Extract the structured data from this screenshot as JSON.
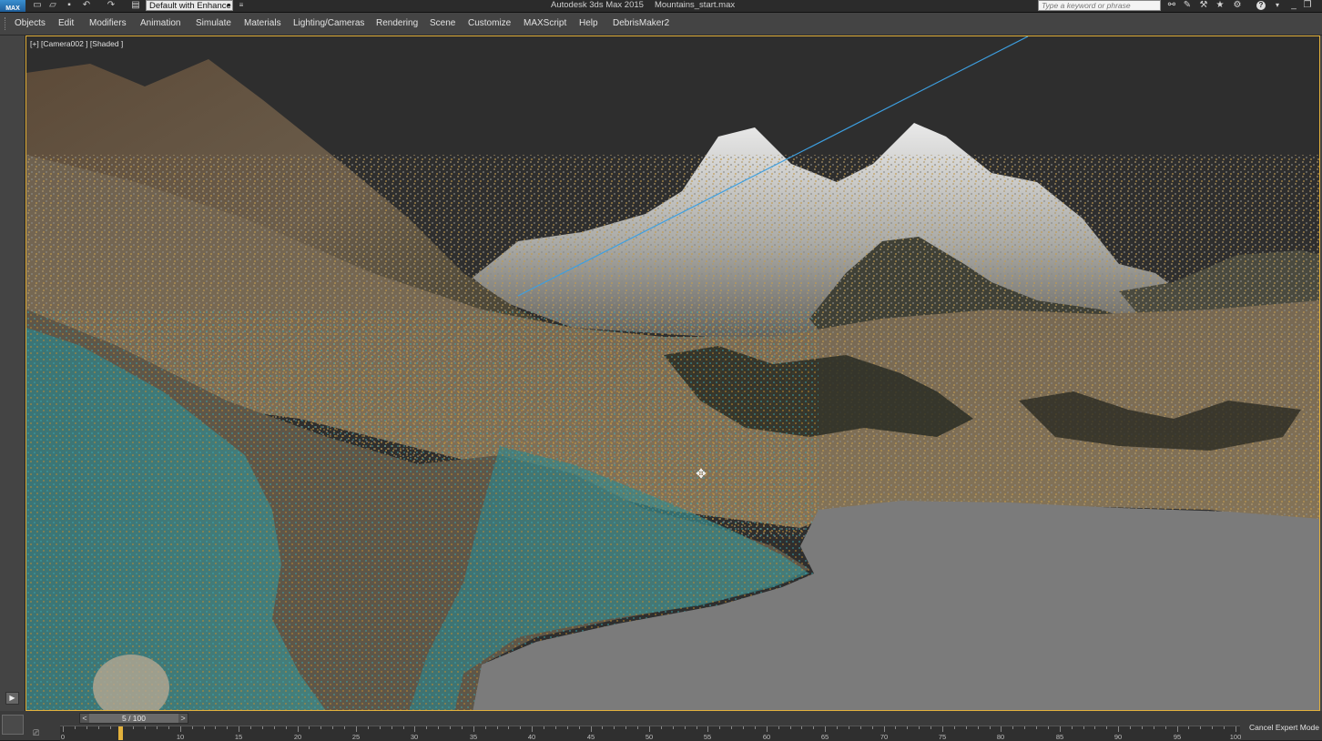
{
  "title_bar": {
    "app_logo_label": "MAX",
    "workspace": "Default with Enhance",
    "app_title": "Autodesk 3ds Max  2015",
    "file_name": "Mountains_start.max",
    "search_placeholder": "Type a keyword or phrase",
    "quick_access_icons": [
      "new-file-icon",
      "open-file-icon",
      "save-icon",
      "undo-icon",
      "redo-icon",
      "project-folder-icon"
    ],
    "right_icons": [
      "binoculars-icon",
      "tools-icon",
      "info-center-icon",
      "star-icon",
      "gear-icon",
      "help-icon"
    ]
  },
  "menubar": {
    "items": [
      "Objects",
      "Edit",
      "Modifiers",
      "Animation",
      "Simulate",
      "Materials",
      "Lighting/Cameras",
      "Rendering",
      "Scene",
      "Customize",
      "MAXScript",
      "Help",
      "DebrisMaker2"
    ]
  },
  "viewport": {
    "label": "[+] [Camera002 ] [Shaded ]",
    "border_color": "#e2b13c",
    "sky_color": "#2e2e2e",
    "water_color": "#7b7b7b",
    "camera_line_color": "#3d9fe0"
  },
  "timeline": {
    "frame_counter": "5 / 100",
    "prev_arrow": "<",
    "next_arrow": ">",
    "current_frame": 5,
    "total_frames": 100,
    "tick_labels": [
      "0",
      "10",
      "15",
      "20",
      "25",
      "30",
      "35",
      "40",
      "45",
      "50",
      "55",
      "60",
      "65",
      "70",
      "75",
      "80",
      "85",
      "90",
      "95",
      "100"
    ],
    "status_text": "Cancel Expert Mode"
  }
}
